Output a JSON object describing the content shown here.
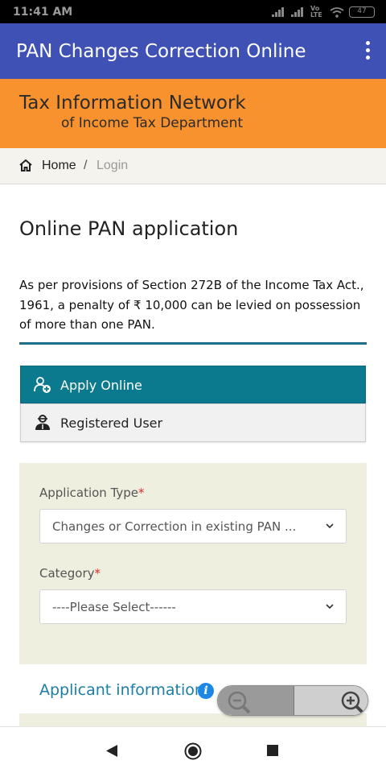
{
  "status_bar": {
    "time": "11:41 AM",
    "network": "Vo LTE",
    "battery": "47"
  },
  "app_bar": {
    "title": "PAN Changes Correction Online"
  },
  "banner": {
    "line1": "Tax Information Network",
    "line2": "of Income Tax Department"
  },
  "breadcrumb": {
    "home": "Home",
    "separator": "/",
    "current": "Login"
  },
  "page": {
    "title": "Online PAN application",
    "notice": "As per provisions of Section 272B of the Income Tax Act., 1961, a penalty of ₹ 10,000 can be levied on possession of more than one PAN."
  },
  "tabs": [
    {
      "label": "Apply Online",
      "icon": "add-user-icon",
      "active": true
    },
    {
      "label": "Registered User",
      "icon": "user-icon",
      "active": false
    }
  ],
  "form": {
    "application_type": {
      "label": "Application Type",
      "required_mark": "*",
      "value": "Changes or Correction in existing PAN ..."
    },
    "category": {
      "label": "Category",
      "required_mark": "*",
      "value": "----Please Select------"
    }
  },
  "section": {
    "title": "Applicant information",
    "icon": "info-icon"
  },
  "colors": {
    "app_bar": "#3f51b5",
    "banner": "#f7922f",
    "active_tab": "#0b7a8e",
    "form_bg": "#efefe0",
    "required": "#d9302c",
    "link": "#1b7ea7"
  }
}
